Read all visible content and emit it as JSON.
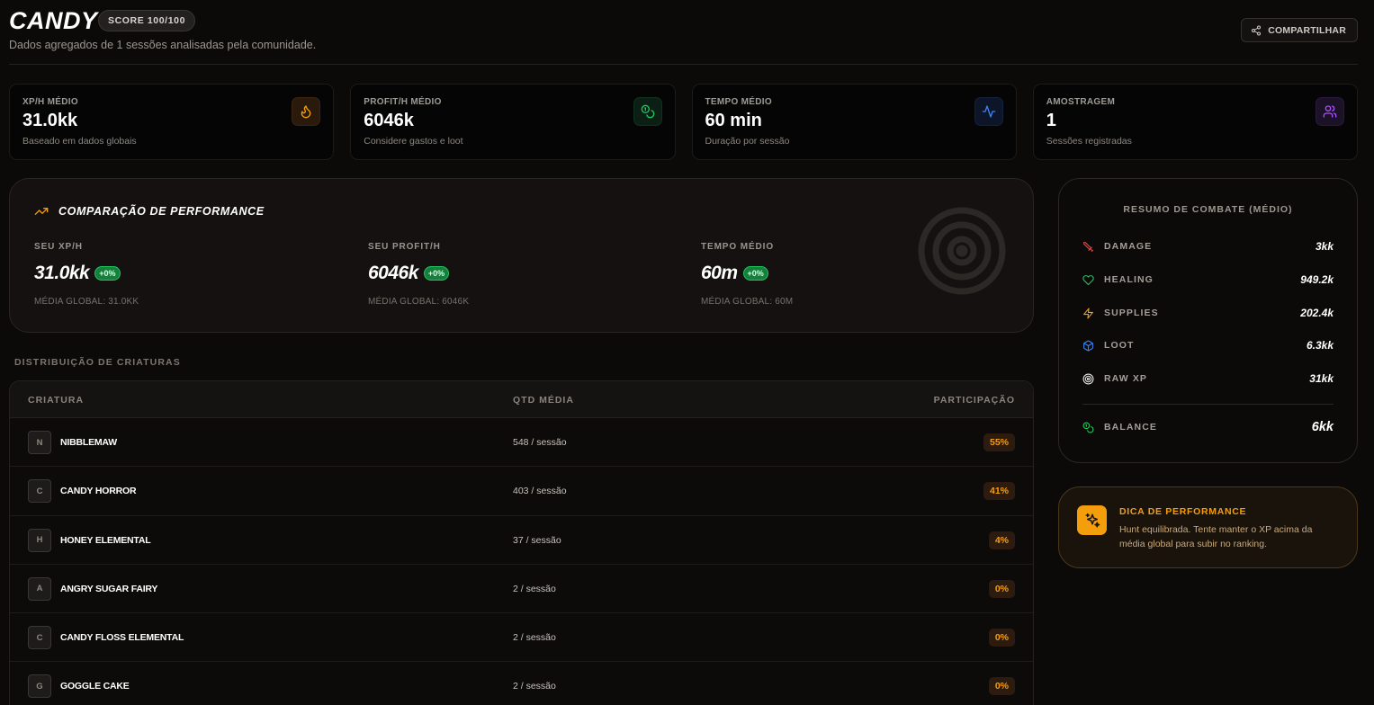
{
  "header": {
    "title": "CANDY",
    "score_badge": "SCORE 100/100",
    "subtitle": "Dados agregados de 1 sessões analisadas pela comunidade.",
    "share_label": "COMPARTILHAR"
  },
  "stats": [
    {
      "label": "XP/H MÉDIO",
      "value": "31.0kk",
      "note": "Baseado em dados globais",
      "icon": "flame-icon",
      "color": "#f59e0b"
    },
    {
      "label": "PROFIT/H MÉDIO",
      "value": "6046k",
      "note": "Considere gastos e loot",
      "icon": "coins-icon",
      "color": "#22c55e"
    },
    {
      "label": "TEMPO MÉDIO",
      "value": "60 min",
      "note": "Duração por sessão",
      "icon": "activity-icon",
      "color": "#3b82f6"
    },
    {
      "label": "AMOSTRAGEM",
      "value": "1",
      "note": "Sessões registradas",
      "icon": "users-icon",
      "color": "#a855f7"
    }
  ],
  "comparison": {
    "title": "COMPARAÇÃO DE PERFORMANCE",
    "columns": [
      {
        "label": "SEU XP/H",
        "value": "31.0kk",
        "badge": "+0%",
        "global": "MÉDIA GLOBAL: 31.0KK"
      },
      {
        "label": "SEU PROFIT/H",
        "value": "6046k",
        "badge": "+0%",
        "global": "MÉDIA GLOBAL: 6046K"
      },
      {
        "label": "TEMPO MÉDIO",
        "value": "60m",
        "badge": "+0%",
        "global": "MÉDIA GLOBAL: 60M"
      }
    ]
  },
  "creatures": {
    "section_title": "DISTRIBUIÇÃO DE CRIATURAS",
    "headers": {
      "name": "CRIATURA",
      "qty": "QTD MÉDIA",
      "share": "PARTICIPAÇÃO"
    },
    "rows": [
      {
        "initial": "N",
        "name": "NIBBLEMAW",
        "qty": "548 / sessão",
        "share": "55%"
      },
      {
        "initial": "C",
        "name": "CANDY HORROR",
        "qty": "403 / sessão",
        "share": "41%"
      },
      {
        "initial": "H",
        "name": "HONEY ELEMENTAL",
        "qty": "37 / sessão",
        "share": "4%"
      },
      {
        "initial": "A",
        "name": "ANGRY SUGAR FAIRY",
        "qty": "2 / sessão",
        "share": "0%"
      },
      {
        "initial": "C",
        "name": "CANDY FLOSS ELEMENTAL",
        "qty": "2 / sessão",
        "share": "0%"
      },
      {
        "initial": "G",
        "name": "GOGGLE CAKE",
        "qty": "2 / sessão",
        "share": "0%"
      }
    ]
  },
  "combat": {
    "title": "RESUMO DE COMBATE (MÉDIO)",
    "rows": [
      {
        "label": "DAMAGE",
        "value": "3kk",
        "icon": "sword-icon",
        "color": "#ef4444"
      },
      {
        "label": "HEALING",
        "value": "949.2k",
        "icon": "heart-icon",
        "color": "#22c55e"
      },
      {
        "label": "SUPPLIES",
        "value": "202.4k",
        "icon": "bolt-icon",
        "color": "#f59e0b"
      },
      {
        "label": "LOOT",
        "value": "6.3kk",
        "icon": "box-icon",
        "color": "#3b82f6"
      },
      {
        "label": "RAW XP",
        "value": "31kk",
        "icon": "target-icon",
        "color": "#e5e5e5"
      }
    ],
    "balance": {
      "label": "BALANCE",
      "value": "6kk",
      "icon": "coins-icon",
      "color": "#22c55e"
    }
  },
  "tip": {
    "title": "DICA DE PERFORMANCE",
    "text": "Hunt equilibrada. Tente manter o XP acima da média global para subir no ranking."
  }
}
